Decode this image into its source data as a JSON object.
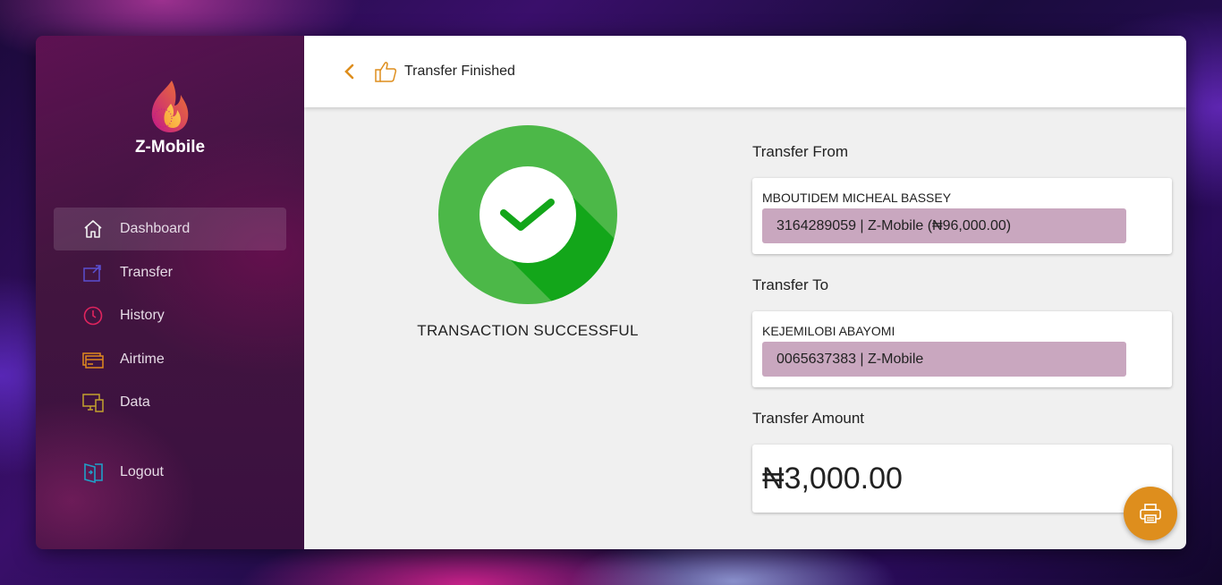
{
  "app": {
    "name": "Z-Mobile"
  },
  "sidebar": {
    "items": [
      {
        "label": "Dashboard",
        "icon": "home-icon",
        "active": true
      },
      {
        "label": "Transfer",
        "icon": "transfer-icon"
      },
      {
        "label": "History",
        "icon": "clock-icon"
      },
      {
        "label": "Airtime",
        "icon": "card-icon"
      },
      {
        "label": "Data",
        "icon": "devices-icon"
      }
    ],
    "logout": {
      "label": "Logout",
      "icon": "logout-icon"
    }
  },
  "header": {
    "title": "Transfer Finished"
  },
  "status": {
    "message": "TRANSACTION SUCCESSFUL"
  },
  "transfer_from": {
    "label": "Transfer From",
    "name": "MBOUTIDEM MICHEAL BASSEY",
    "account": "3164289059 | Z-Mobile (₦96,000.00)"
  },
  "transfer_to": {
    "label": "Transfer To",
    "name": "KEJEMILOBI ABAYOMI",
    "account": "0065637383 | Z-Mobile"
  },
  "transfer_amount": {
    "label": "Transfer Amount",
    "value": "₦3,000.00"
  },
  "colors": {
    "accent": "#de8e1d",
    "success": "#4cb848",
    "account_highlight": "#c9a7bf"
  }
}
